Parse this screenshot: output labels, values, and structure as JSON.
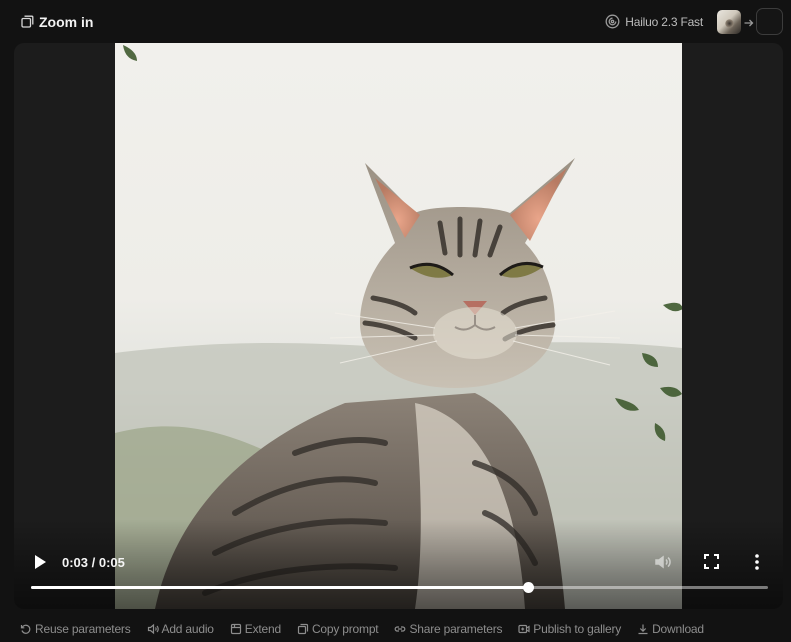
{
  "header": {
    "title": "Zoom in",
    "model_name": "Hailuo 2.3 Fast"
  },
  "player": {
    "time_display": "0:03 / 0:05",
    "progress_fraction": 0.674
  },
  "actions": [
    {
      "label": "Reuse parameters",
      "icon": "reuse-icon"
    },
    {
      "label": "Add audio",
      "icon": "audio-icon"
    },
    {
      "label": "Extend",
      "icon": "extend-icon"
    },
    {
      "label": "Copy prompt",
      "icon": "copy-icon"
    },
    {
      "label": "Share parameters",
      "icon": "link-icon"
    },
    {
      "label": "Publish to gallery",
      "icon": "publish-icon"
    },
    {
      "label": "Download",
      "icon": "download-icon"
    }
  ],
  "colors": {
    "background": "#121212",
    "panel": "#1c1c1c",
    "action_text": "#8d8d8d"
  }
}
